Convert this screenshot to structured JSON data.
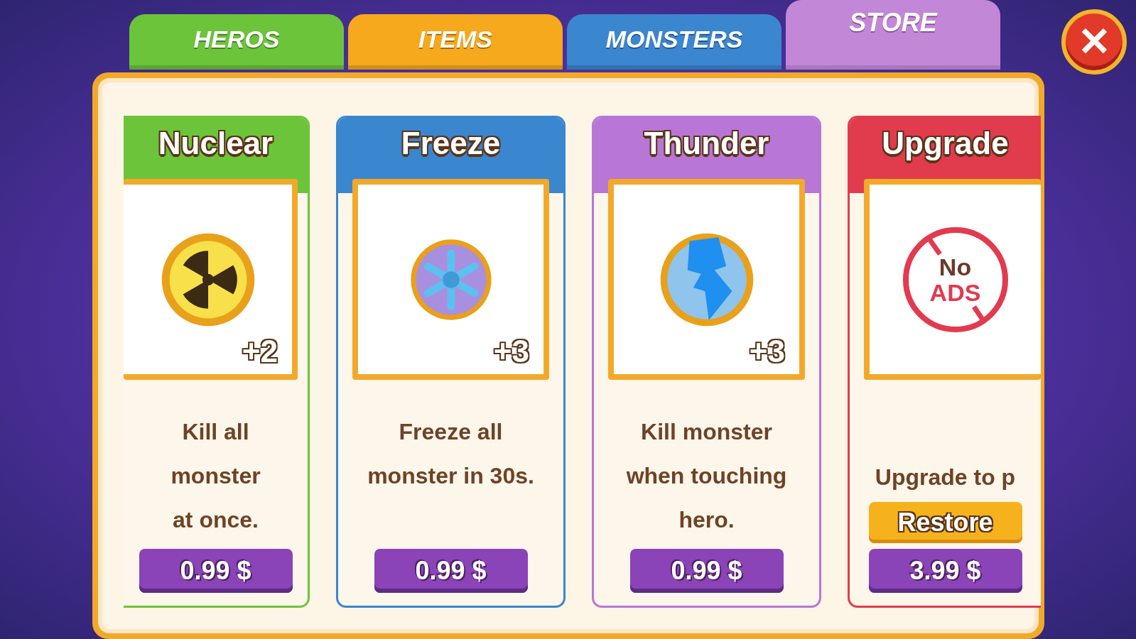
{
  "tabs": [
    {
      "label": "HEROS",
      "color": "#6cc43a",
      "selected": false
    },
    {
      "label": "ITEMS",
      "color": "#f6a91c",
      "selected": false
    },
    {
      "label": "MONSTERS",
      "color": "#3a86cf",
      "selected": false
    },
    {
      "label": "STORE",
      "color": "#c387d8",
      "selected": true
    }
  ],
  "close_button": {
    "label": "✕"
  },
  "cards": [
    {
      "title": "Nuclear",
      "color": "#6cc43a",
      "kind": "nuclear",
      "count": "+2",
      "description": [
        "Kill all",
        "monster",
        "at once."
      ],
      "price": "0.99 $"
    },
    {
      "title": "Freeze",
      "color": "#3a86cf",
      "kind": "freeze",
      "count": "+3",
      "description": [
        "Freeze all",
        "monster in 30s."
      ],
      "price": "0.99 $"
    },
    {
      "title": "Thunder",
      "color": "#b876d6",
      "kind": "thunder",
      "count": "+3",
      "description": [
        "Kill monster",
        "when touching",
        "hero."
      ],
      "price": "0.99 $"
    },
    {
      "title": "Upgrade",
      "color": "#e03c4e",
      "kind": "noads",
      "icon_text": [
        "No",
        "ADS"
      ],
      "description": [
        "Upgrade to p"
      ],
      "restore": "Restore",
      "price": "3.99 $"
    }
  ]
}
